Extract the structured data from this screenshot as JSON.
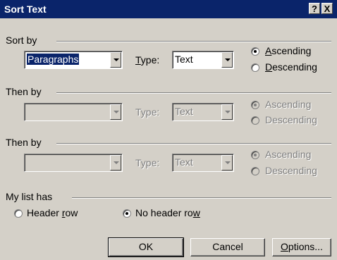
{
  "window": {
    "title": "Sort Text",
    "help_glyph": "?",
    "close_glyph": "X"
  },
  "sort_by": {
    "label": "Sort by",
    "field_value": "Paragraphs",
    "type_label": "Type:",
    "type_value": "Text",
    "ascending": "Ascending",
    "descending": "Descending",
    "selected": "ascending"
  },
  "then_by_1": {
    "label": "Then by",
    "field_value": "",
    "type_label": "Type:",
    "type_value": "Text",
    "ascending": "Ascending",
    "descending": "Descending",
    "selected": "ascending"
  },
  "then_by_2": {
    "label": "Then by",
    "field_value": "",
    "type_label": "Type:",
    "type_value": "Text",
    "ascending": "Ascending",
    "descending": "Descending",
    "selected": "ascending"
  },
  "my_list_has": {
    "label": "My list has",
    "header_row": "Header row",
    "no_header_row": "No header row",
    "selected": "no_header_row"
  },
  "buttons": {
    "ok": "OK",
    "cancel": "Cancel",
    "options": "Options..."
  }
}
